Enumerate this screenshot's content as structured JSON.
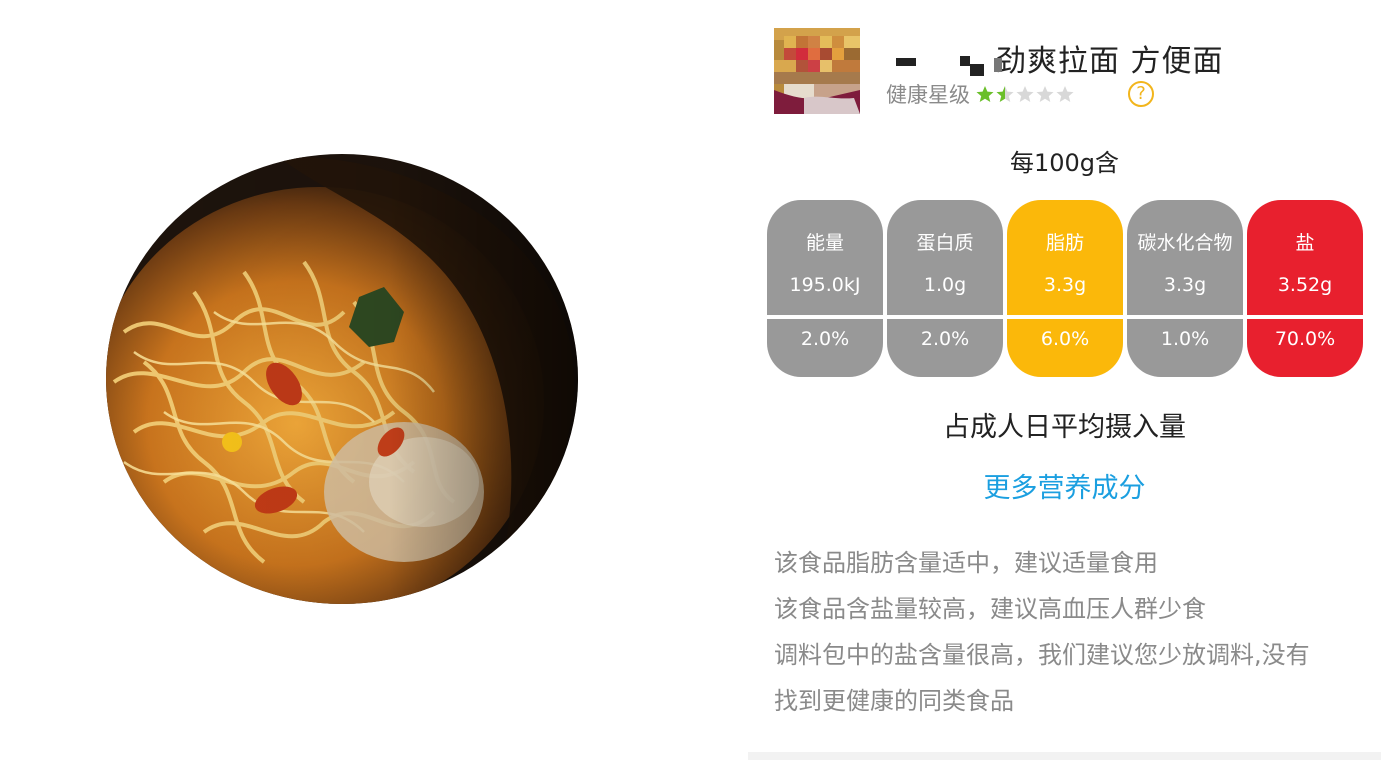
{
  "product": {
    "name_suffix": "劲爽拉面 方便面",
    "health_label": "健康星级",
    "rating": 1.5,
    "rating_max": 5,
    "star_filled_color": "#6abf2a",
    "star_empty_color": "#d8d8d8",
    "help_icon": "question-circle-icon"
  },
  "nutrition": {
    "per_label": "每100g含",
    "columns": [
      {
        "name": "能量",
        "value": "195.0kJ",
        "percent": "2.0%",
        "color": "#999999"
      },
      {
        "name": "蛋白质",
        "value": "1.0g",
        "percent": "2.0%",
        "color": "#999999"
      },
      {
        "name": "脂肪",
        "value": "3.3g",
        "percent": "6.0%",
        "color": "#fbb80a"
      },
      {
        "name": "碳水化合物",
        "value": "3.3g",
        "percent": "1.0%",
        "color": "#999999"
      },
      {
        "name": "盐",
        "value": "3.52g",
        "percent": "70.0%",
        "color": "#e8202e"
      }
    ],
    "daily_label": "占成人日平均摄入量",
    "more_link": "更多营养成分"
  },
  "advice": [
    "该食品脂肪含量适中，建议适量食用",
    "该食品含盐量较高，建议高血压人群少食",
    "调料包中的盐含量很高，我们建议您少放调料,没有",
    "找到更健康的同类食品"
  ]
}
